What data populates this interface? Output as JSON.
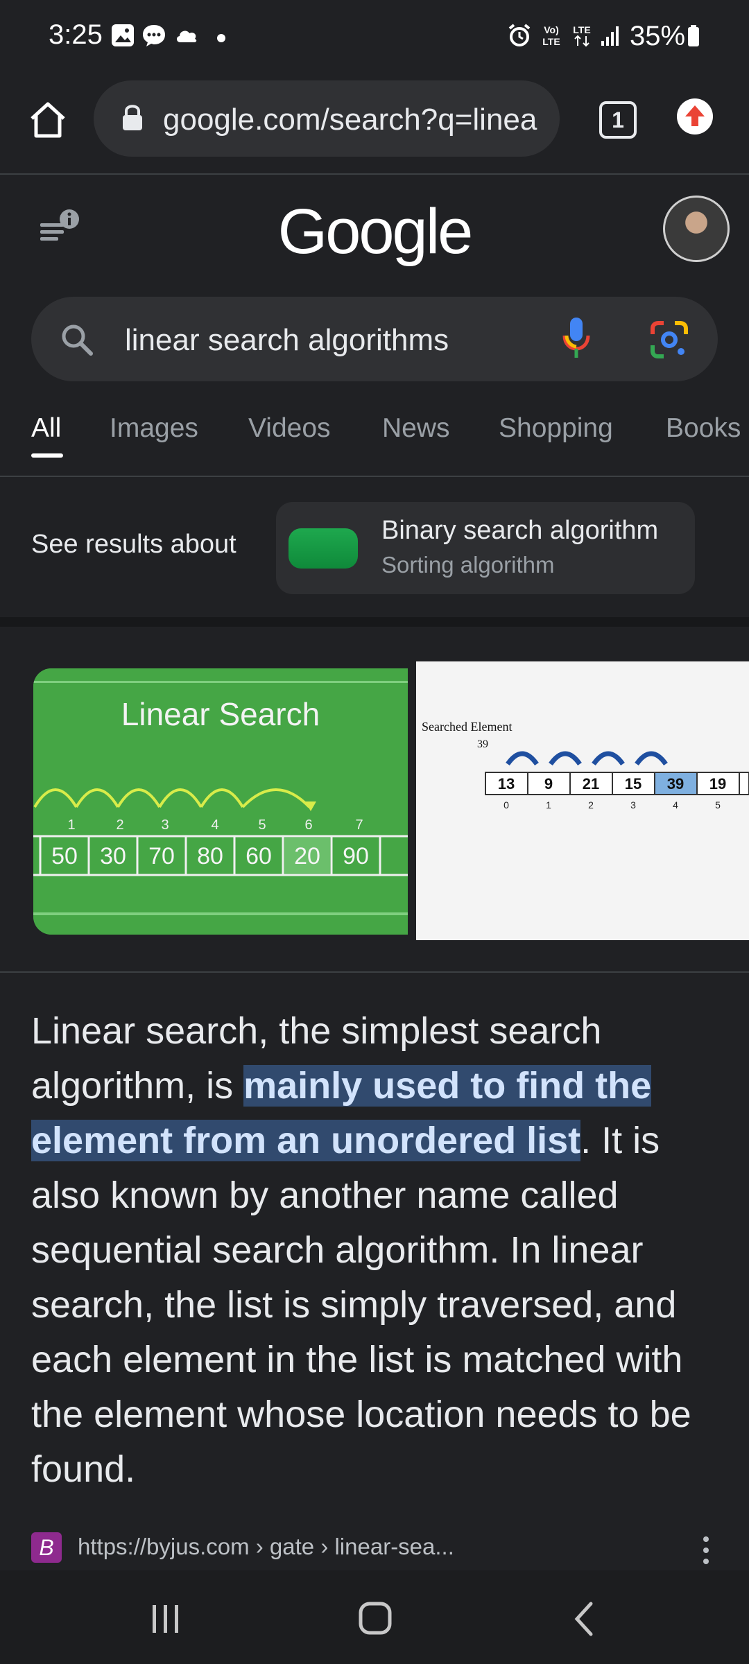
{
  "status_bar": {
    "time": "3:25",
    "battery": "35%",
    "icons": [
      "gallery-icon",
      "message-icon",
      "cloud-icon",
      "dot-icon",
      "alarm-icon",
      "volte-icon",
      "lte-icon",
      "signal-icon",
      "battery-icon"
    ]
  },
  "browser": {
    "url": "google.com/search?q=linea",
    "tab_count": "1"
  },
  "google": {
    "logo": "Google",
    "search_query": "linear search algorithms"
  },
  "tabs": [
    "All",
    "Images",
    "Videos",
    "News",
    "Shopping",
    "Books"
  ],
  "see_results": {
    "label": "See results about",
    "card_title": "Binary search algorithm",
    "card_subtitle": "Sorting algorithm"
  },
  "images": {
    "image1_title": "Linear Search",
    "image1_indices": [
      "1",
      "2",
      "3",
      "4",
      "5",
      "6",
      "7"
    ],
    "image1_values": [
      "50",
      "30",
      "70",
      "80",
      "60",
      "20",
      "90"
    ],
    "image2_label": "Searched Element",
    "image2_target": "39",
    "image2_values": [
      "13",
      "9",
      "21",
      "15",
      "39",
      "19"
    ],
    "image2_indices": [
      "0",
      "1",
      "2",
      "3",
      "4",
      "5"
    ]
  },
  "description": {
    "part1": "Linear search, the simplest search algorithm, is ",
    "highlight": "mainly used to find the element from an unordered list",
    "part2": ". It is also known by another name called sequential search algorithm. In linear search, the list is simply traversed, and each element in the list is matched with the element whose location needs to be found."
  },
  "source": {
    "favicon_letter": "B",
    "url": "https://byjus.com › gate › linear-sea..."
  },
  "colors": {
    "background": "#202124",
    "highlight": "#314a6e",
    "mic_blue": "#4285f4",
    "update_red": "#ea4335"
  }
}
